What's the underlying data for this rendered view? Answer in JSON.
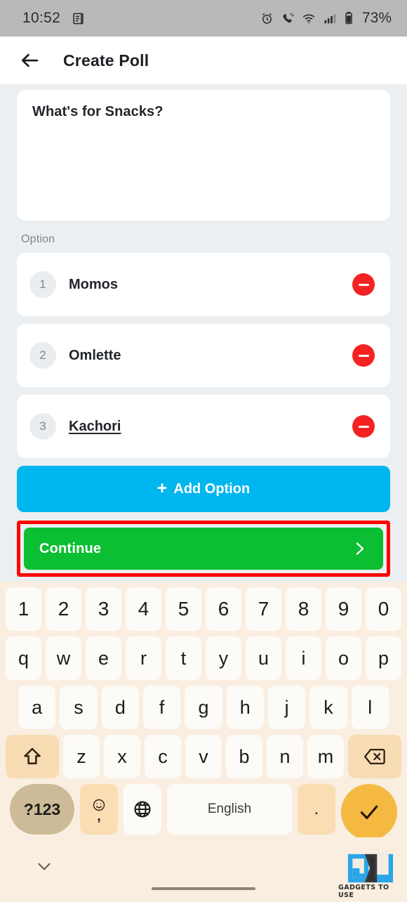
{
  "status_bar": {
    "time": "10:52",
    "battery_percent": "73%",
    "icons": [
      "notification-doc-icon",
      "alarm-icon",
      "call-vibrate-icon",
      "wifi-icon",
      "signal-icon",
      "battery-icon"
    ]
  },
  "app_bar": {
    "back_icon": "arrow-left-icon",
    "title": "Create Poll"
  },
  "form": {
    "question_value": "What's for Snacks?",
    "option_section_label": "Option",
    "options": [
      {
        "index": "1",
        "value": "Momos",
        "editing": false
      },
      {
        "index": "2",
        "value": "Omlette",
        "editing": false
      },
      {
        "index": "3",
        "value": "Kachori",
        "editing": true
      }
    ],
    "add_option_label": "Add Option",
    "add_option_plus": "+",
    "continue_label": "Continue",
    "continue_chevron_icon": "chevron-right-icon"
  },
  "colors": {
    "page_bg": "#eceff1",
    "add_option_blue": "#00b6ef",
    "continue_green": "#0cbf32",
    "remove_red": "#f42222",
    "highlight_red": "#fe0000",
    "keyboard_bg": "#faeee1",
    "enter_key_yellow": "#f5b942"
  },
  "keyboard": {
    "row_numbers": [
      "1",
      "2",
      "3",
      "4",
      "5",
      "6",
      "7",
      "8",
      "9",
      "0"
    ],
    "row_top": [
      "q",
      "w",
      "e",
      "r",
      "t",
      "y",
      "u",
      "i",
      "o",
      "p"
    ],
    "row_home": [
      "a",
      "s",
      "d",
      "f",
      "g",
      "h",
      "j",
      "k",
      "l"
    ],
    "row_bottom": [
      "z",
      "x",
      "c",
      "v",
      "b",
      "n",
      "m"
    ],
    "shift_icon": "shift-arrow-icon",
    "backspace_icon": "backspace-icon",
    "symbols_label": "?123",
    "emoji_icon": "emoji-smiley-icon",
    "comma_label": ",",
    "globe_icon": "globe-icon",
    "space_label": "English",
    "period_label": ".",
    "enter_icon": "check-icon"
  },
  "nav": {
    "hide_keyboard_icon": "chevron-down-icon",
    "gesture_bar": "home-gesture-bar"
  },
  "watermark": {
    "brand": "GADGETS TO USE",
    "logo": "gu-logo"
  }
}
